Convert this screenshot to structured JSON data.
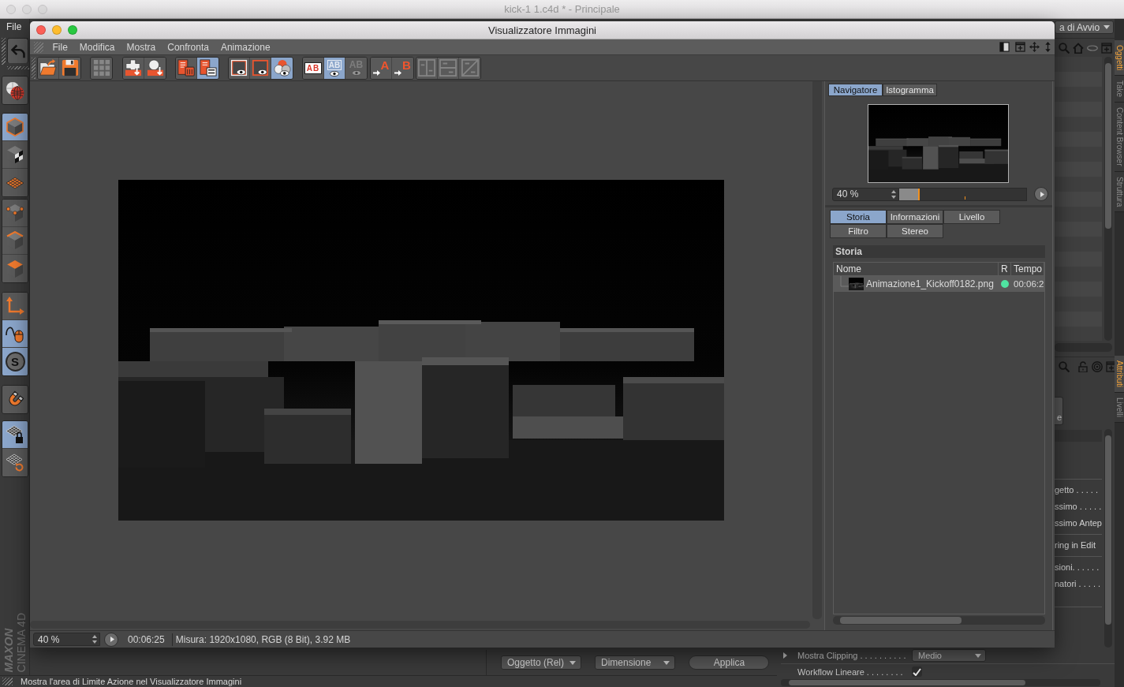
{
  "main_window": {
    "title": "kick-1 1.c4d * - Principale",
    "menu": [
      "File"
    ],
    "layout_dropdown": "a di Avvio"
  },
  "left_toolbar": [
    {
      "tools": [
        {
          "selected": false
        }
      ]
    },
    {
      "tools": [
        {
          "selected": false
        }
      ]
    },
    {
      "tools": [
        {
          "selected": true
        },
        {
          "selected": false
        },
        {
          "selected": false
        }
      ]
    },
    {
      "tools": [
        {
          "selected": false
        },
        {
          "selected": false
        },
        {
          "selected": false
        }
      ]
    },
    {
      "tools": [
        {
          "selected": false
        },
        {
          "selected": true
        },
        {
          "selected": true,
          "label": "S"
        }
      ]
    },
    {
      "tools": [
        {
          "selected": false
        }
      ]
    },
    {
      "tools": [
        {
          "selected": true
        },
        {
          "selected": false
        }
      ]
    }
  ],
  "logo": [
    "MAXON",
    "CINEMA 4D"
  ],
  "side_tabs": [
    {
      "label": "Oggetti",
      "selected": true
    },
    {
      "label": "Take",
      "selected": false
    },
    {
      "label": "Content Browser",
      "selected": false
    },
    {
      "label": "Struttura",
      "selected": false
    }
  ],
  "side_tabs_lower": [
    {
      "label": "Attributi",
      "selected": true
    },
    {
      "label": "Livelli",
      "selected": false
    }
  ],
  "attributes": {
    "button_fragment": "e",
    "groups": [
      [
        "getto . . . . .",
        "ssimo . . . . .",
        "ssimo Antep"
      ],
      [
        "ring in Edit"
      ],
      [
        "sioni. . . . . .",
        "natori . . . . ."
      ]
    ]
  },
  "coordinate_buttons": [
    {
      "label": "Oggetto (Rel)",
      "kind": "dropdown"
    },
    {
      "label": "Dimensione",
      "kind": "dropdown"
    },
    {
      "label": "Applica",
      "kind": "button"
    }
  ],
  "render_settings": [
    {
      "kind": "dropdown",
      "label": "Mostra Clipping . . . . . . . . . .",
      "value": "Medio"
    },
    {
      "kind": "checkbox",
      "label": "Workflow Lineare . . . . . . . .",
      "checked": true
    }
  ],
  "status_bar": "Mostra l'area di Limite Azione nel Visualizzatore Immagini",
  "viewer": {
    "title": "Visualizzatore Immagini",
    "menu": [
      "File",
      "Modifica",
      "Mostra",
      "Confronta",
      "Animazione"
    ],
    "toolbar": [
      {
        "tools": [
          {
            "selected": false,
            "disabled": false
          },
          {
            "selected": false,
            "disabled": false
          }
        ]
      },
      {
        "tools": [
          {
            "selected": false,
            "disabled": true
          }
        ]
      },
      {
        "tools": [
          {
            "selected": false,
            "disabled": false
          },
          {
            "selected": false,
            "disabled": false
          }
        ]
      },
      {
        "tools": [
          {
            "selected": false,
            "disabled": false
          },
          {
            "selected": true,
            "disabled": false
          }
        ]
      },
      {
        "tools": [
          {
            "selected": false,
            "disabled": false
          },
          {
            "selected": false,
            "disabled": false
          },
          {
            "selected": true,
            "disabled": false
          }
        ]
      },
      {
        "tools": [
          {
            "label": "AB",
            "selected": false,
            "disabled": false
          },
          {
            "label": "AB",
            "selected": true,
            "disabled": false
          },
          {
            "label": "AB",
            "selected": false,
            "disabled": true
          }
        ]
      },
      {
        "tools": [
          {
            "label": "A",
            "selected": false,
            "disabled": false
          },
          {
            "label": "B",
            "selected": false,
            "disabled": false
          }
        ]
      },
      {
        "tools": [
          {
            "selected": false,
            "disabled": true
          },
          {
            "selected": false,
            "disabled": true
          },
          {
            "selected": false,
            "disabled": true
          }
        ]
      }
    ],
    "navigator": {
      "tabs": [
        {
          "label": "Navigatore",
          "selected": true
        },
        {
          "label": "Istogramma",
          "selected": false
        }
      ],
      "zoom": "40 %",
      "slider": {
        "level": 0.16
      }
    },
    "info_tabs": [
      {
        "label": "Storia",
        "selected": true
      },
      {
        "label": "Informazioni",
        "selected": false
      },
      {
        "label": "Livello",
        "selected": false
      },
      {
        "label": "Filtro",
        "selected": false
      },
      {
        "label": "Stereo",
        "selected": false
      }
    ],
    "history": {
      "title": "Storia",
      "columns": [
        "Nome",
        "R",
        "Tempo"
      ],
      "rows": [
        {
          "name": "Animazione1_Kickoff0182.png",
          "color": "#4fe3a1",
          "time": "00:06:2",
          "selected": true
        }
      ]
    },
    "status": {
      "zoom": "40 %",
      "time": "00:06:25",
      "info": "Misura: 1920x1080, RGB (8 Bit), 3.92 MB"
    }
  }
}
